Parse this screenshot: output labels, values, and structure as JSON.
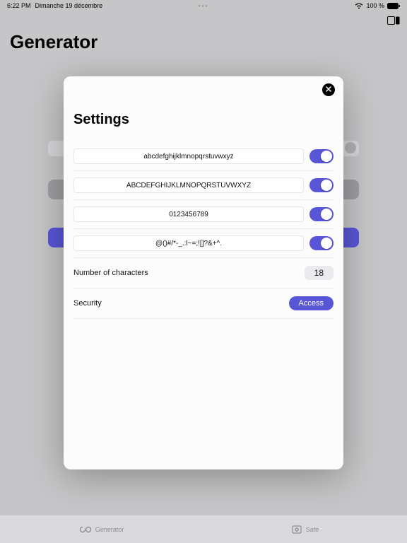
{
  "status": {
    "time": "6:22 PM",
    "date": "Dimanche 19 décembre",
    "battery_pct": "100 %"
  },
  "page": {
    "title": "Generator"
  },
  "modal": {
    "title": "Settings",
    "charsets": [
      {
        "value": "abcdefghijklmnopqrstuvwxyz"
      },
      {
        "value": "ABCDEFGHIJKLMNOPQRSTUVWXYZ"
      },
      {
        "value": "0123456789"
      },
      {
        "value": "@()#/*-_.:l~=;![]?&+^."
      }
    ],
    "num_chars_label": "Number of characters",
    "num_chars_value": "18",
    "security_label": "Security",
    "security_button": "Access"
  },
  "tabs": {
    "generator": "Generator",
    "safe": "Safe"
  }
}
